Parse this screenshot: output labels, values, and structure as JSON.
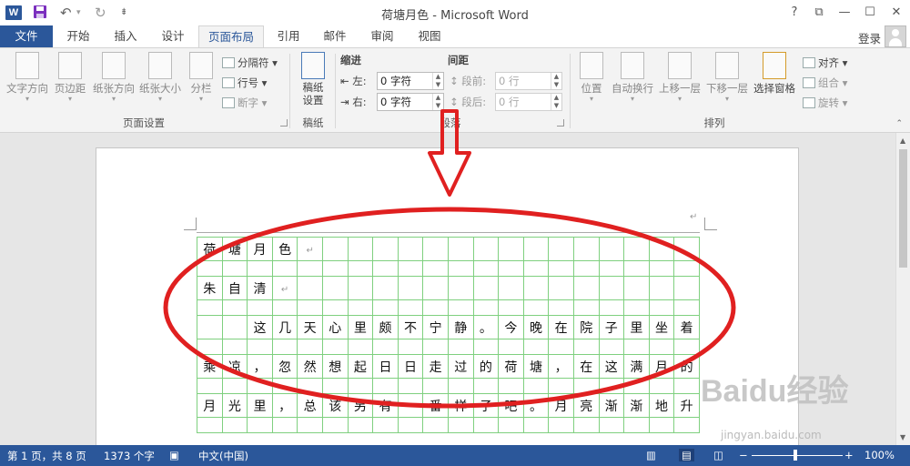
{
  "window": {
    "title": "荷塘月色 - Microsoft Word",
    "controls": [
      "?",
      "⧉",
      "—",
      "☐",
      "✕"
    ]
  },
  "qat": {
    "save": "💾",
    "undo": "↶",
    "redo": "↻",
    "more": "⇟"
  },
  "tabs": [
    {
      "label": "文件",
      "active": false,
      "file": true
    },
    {
      "label": "开始",
      "active": false
    },
    {
      "label": "插入",
      "active": false
    },
    {
      "label": "设计",
      "active": false
    },
    {
      "label": "页面布局",
      "active": true
    },
    {
      "label": "引用",
      "active": false
    },
    {
      "label": "邮件",
      "active": false
    },
    {
      "label": "审阅",
      "active": false
    },
    {
      "label": "视图",
      "active": false
    }
  ],
  "signin": "登录",
  "ribbon": {
    "page_setup": {
      "label": "页面设置",
      "buttons": [
        "文字方向",
        "页边距",
        "纸张方向",
        "纸张大小",
        "分栏"
      ],
      "small": [
        "分隔符",
        "行号",
        "断字"
      ]
    },
    "manuscript": {
      "label": "稿纸",
      "button": "稿纸\n设置"
    },
    "paragraph": {
      "label": "段落",
      "indent_label": "缩进",
      "spacing_label": "间距",
      "left_label": "左:",
      "right_label": "右:",
      "left_value": "0 字符",
      "right_value": "0 字符",
      "before_label": "段前:",
      "after_label": "段后:",
      "before_value": "0 行",
      "after_value": "0 行"
    },
    "arrange": {
      "label": "排列",
      "buttons": [
        "位置",
        "自动换行",
        "上移一层",
        "下移一层",
        "选择窗格"
      ],
      "small": [
        "对齐",
        "组合",
        "旋转"
      ]
    }
  },
  "document": {
    "rows": [
      [
        "荷",
        "塘",
        "月",
        "色",
        "",
        "",
        "",
        "",
        "",
        "",
        "",
        "",
        "",
        "",
        "",
        "",
        "",
        "",
        "",
        ""
      ],
      [
        "朱",
        "自",
        "清",
        "",
        "",
        "",
        "",
        "",
        "",
        "",
        "",
        "",
        "",
        "",
        "",
        "",
        "",
        "",
        "",
        ""
      ],
      [
        "",
        "",
        "这",
        "几",
        "天",
        "心",
        "里",
        "颇",
        "不",
        "宁",
        "静",
        "。",
        "今",
        "晚",
        "在",
        "院",
        "子",
        "里",
        "坐",
        "着"
      ],
      [
        "乘",
        "凉",
        "，",
        "忽",
        "然",
        "想",
        "起",
        "日",
        "日",
        "走",
        "过",
        "的",
        "荷",
        "塘",
        "，",
        "在",
        "这",
        "满",
        "月",
        "的"
      ],
      [
        "月",
        "光",
        "里",
        "，",
        "总",
        "该",
        "另",
        "有",
        "一",
        "番",
        "样",
        "子",
        "吧",
        "。",
        "月",
        "亮",
        "渐",
        "渐",
        "地",
        "升"
      ]
    ],
    "para_mark": "↵"
  },
  "status": {
    "page": "第 1 页，共 8 页",
    "words": "1373 个字",
    "proof": "▣",
    "language": "中文(中国)",
    "zoom": "100%",
    "zoom_minus": "−",
    "zoom_plus": "+"
  },
  "watermark": {
    "text": "Baidu经验",
    "sub": "jingyan.baidu.com"
  },
  "annotation_color": "#e02020",
  "accent": "#2b579a"
}
